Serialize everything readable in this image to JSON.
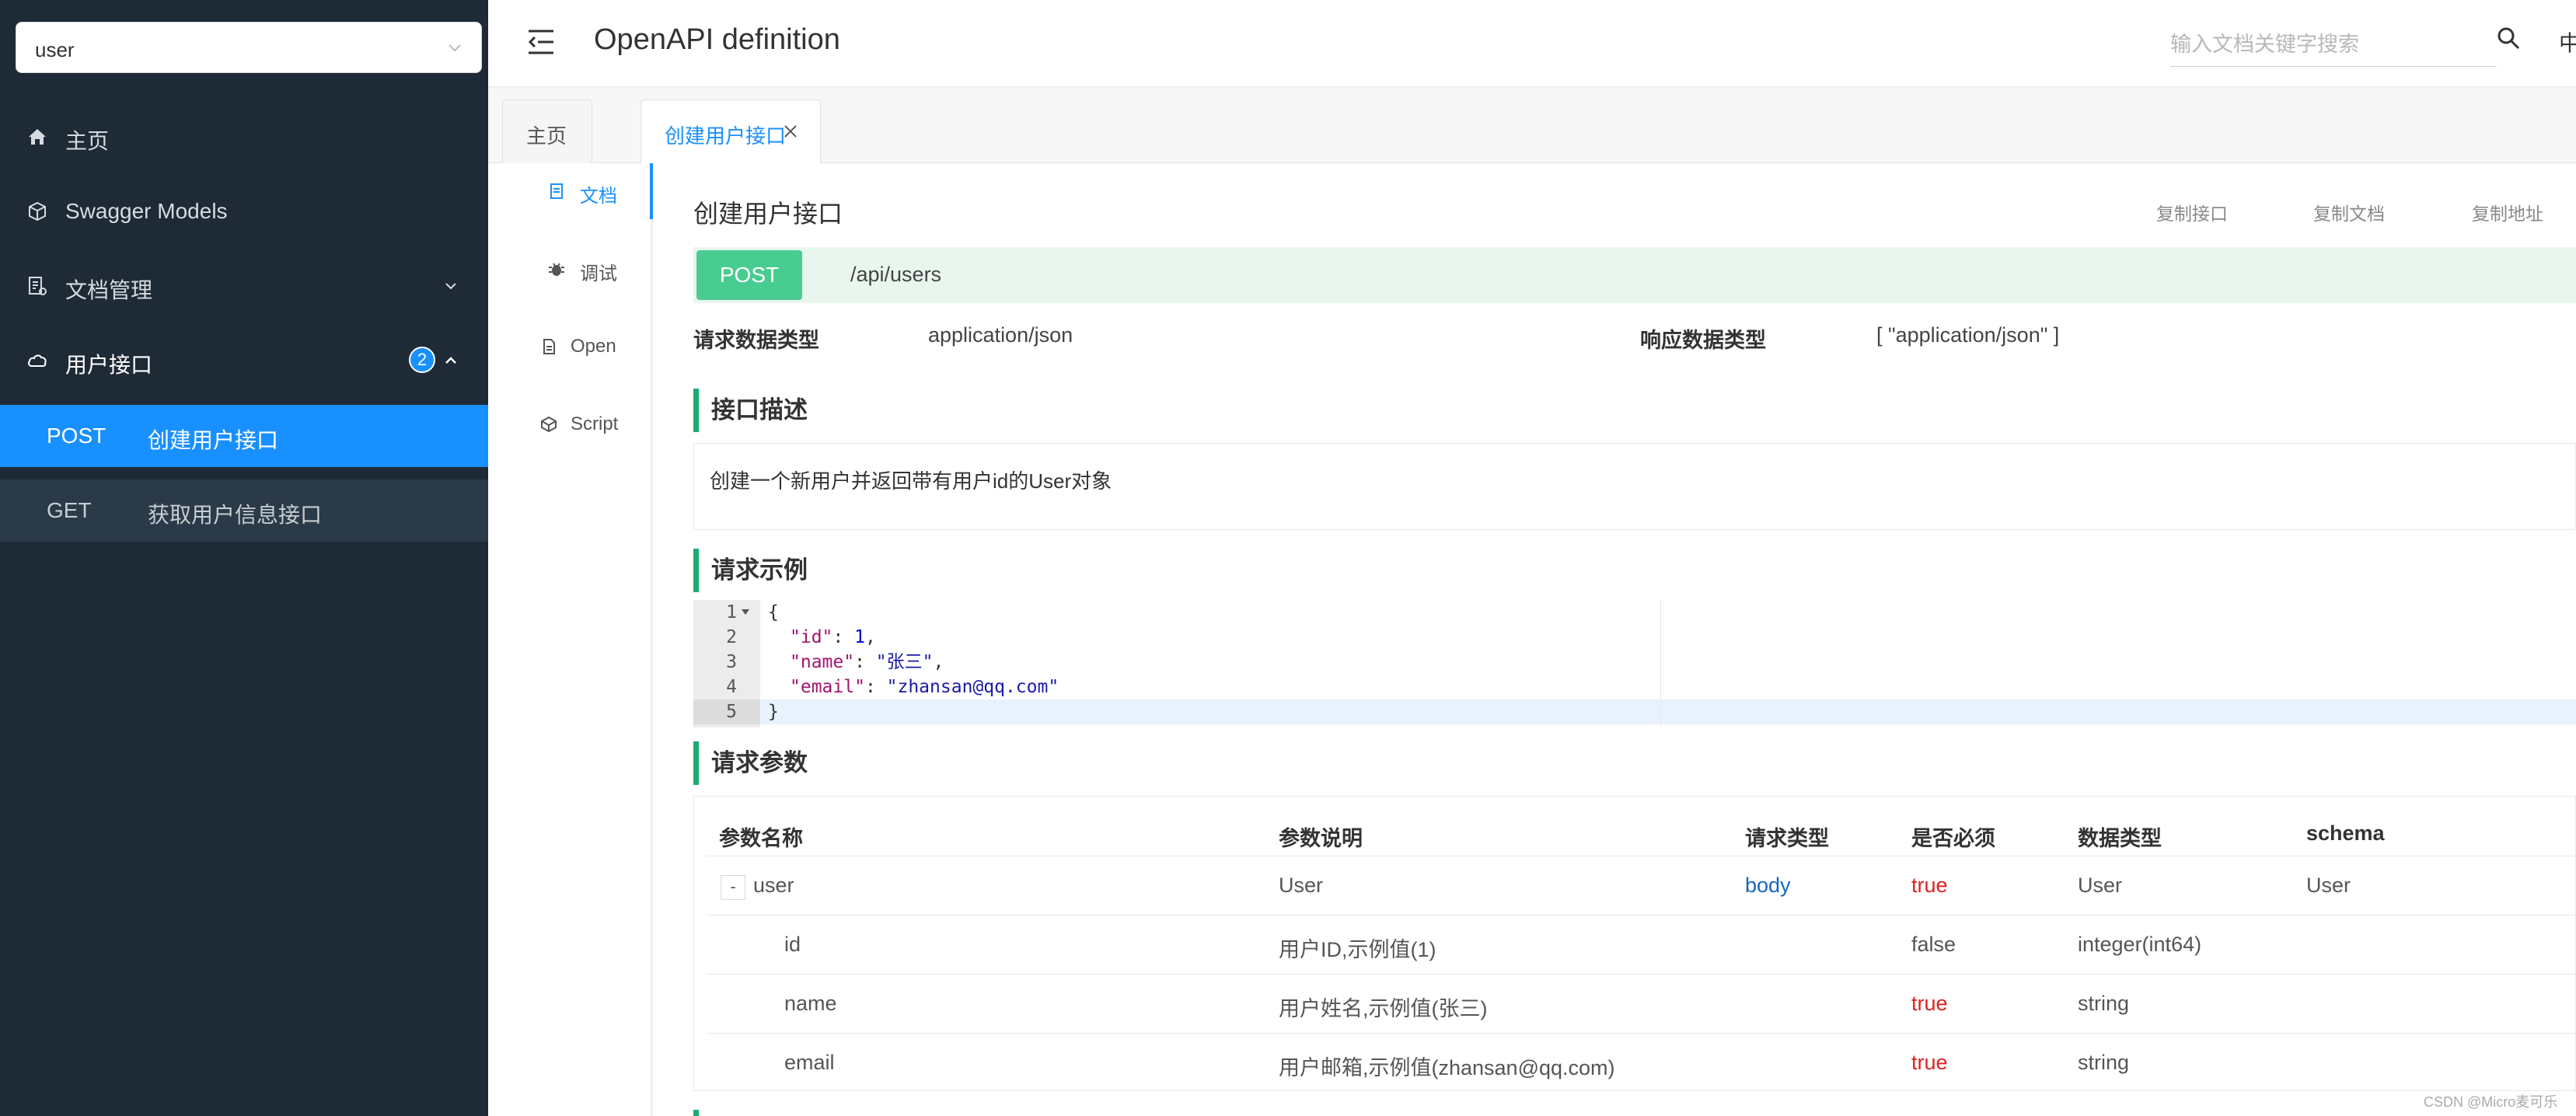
{
  "sidebar": {
    "group_select": {
      "value": "user"
    },
    "menu": [
      {
        "label": "主页",
        "icon": "home-icon"
      },
      {
        "label": "Swagger Models",
        "icon": "models-icon"
      },
      {
        "label": "文档管理",
        "icon": "docs-manage-icon"
      },
      {
        "label": "用户接口",
        "icon": "cloud-icon",
        "badge": "2"
      }
    ],
    "sub_items": [
      {
        "method": "POST",
        "name": "创建用户接口",
        "active": true
      },
      {
        "method": "GET",
        "name": "获取用户信息接口",
        "active": false
      }
    ]
  },
  "header": {
    "title": "OpenAPI definition",
    "search_placeholder": "输入文档关键字搜索",
    "lang": "中"
  },
  "tabs": [
    {
      "label": "主页"
    },
    {
      "label": "创建用户接口"
    }
  ],
  "doc_nav": [
    {
      "label": "文档",
      "icon": "document-icon"
    },
    {
      "label": "调试",
      "icon": "bug-icon"
    },
    {
      "label": "Open",
      "icon": "file-icon"
    },
    {
      "label": "Script",
      "icon": "script-icon"
    }
  ],
  "api": {
    "title": "创建用户接口",
    "actions": [
      "复制接口",
      "复制文档",
      "复制地址"
    ],
    "method": "POST",
    "path": "/api/users",
    "request_type_label": "请求数据类型",
    "request_type": "application/json",
    "response_type_label": "响应数据类型",
    "response_type": "[ \"application/json\" ]",
    "desc_title": "接口描述",
    "description": "创建一个新用户并返回带有用户id的User对象",
    "example_title": "请求示例",
    "code": {
      "line_numbers": [
        "1",
        "2",
        "3",
        "4",
        "5"
      ],
      "open_brace": "{",
      "close_brace": "}",
      "id_key": "\"id\"",
      "id_val": "1",
      "name_key": "\"name\"",
      "name_val": "\"张三\"",
      "email_key": "\"email\"",
      "email_val": "\"zhansan@qq.com\"",
      "colon": ": ",
      "comma": ","
    },
    "params_title": "请求参数",
    "params_headers": [
      "参数名称",
      "参数说明",
      "请求类型",
      "是否必须",
      "数据类型",
      "schema"
    ],
    "params_rows": [
      {
        "expander": "-",
        "name": "user",
        "desc": "User",
        "in": "body",
        "required": "true",
        "type": "User",
        "schema": "User"
      },
      {
        "name": "id",
        "desc": "用户ID,示例值(1)",
        "in": "",
        "required": "false",
        "type": "integer(int64)",
        "schema": ""
      },
      {
        "name": "name",
        "desc": "用户姓名,示例值(张三)",
        "in": "",
        "required": "true",
        "type": "string",
        "schema": ""
      },
      {
        "name": "email",
        "desc": "用户邮箱,示例值(zhansan@qq.com)",
        "in": "",
        "required": "true",
        "type": "string",
        "schema": ""
      }
    ]
  },
  "watermark": "CSDN @Micro麦可乐",
  "colors": {
    "sidebar_bg": "#1e2a36",
    "accent": "#1890ff",
    "post_green": "#49cc90",
    "section_bar": "#1aab74",
    "required_red": "#e02020"
  }
}
